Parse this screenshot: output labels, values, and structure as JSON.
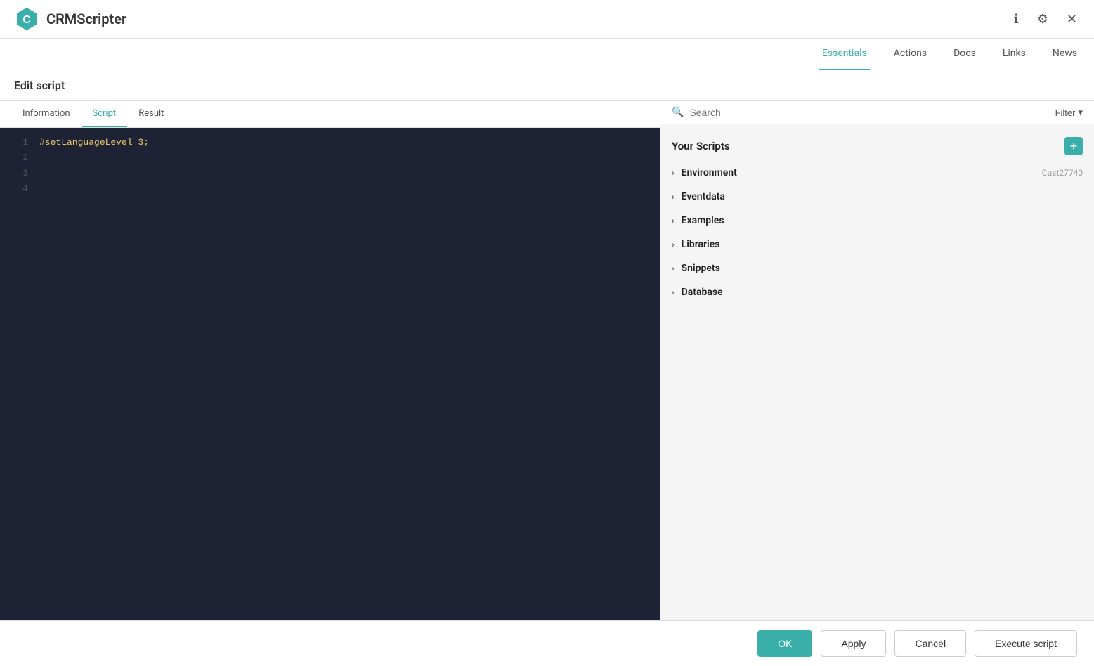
{
  "app": {
    "title": "CRMScripter",
    "logo_text": "C"
  },
  "nav": {
    "items": [
      {
        "id": "essentials",
        "label": "Essentials",
        "active": true
      },
      {
        "id": "actions",
        "label": "Actions",
        "active": false
      },
      {
        "id": "docs",
        "label": "Docs",
        "active": false
      },
      {
        "id": "links",
        "label": "Links",
        "active": false
      },
      {
        "id": "news",
        "label": "News",
        "active": false
      }
    ]
  },
  "page": {
    "title": "Edit script"
  },
  "tabs": [
    {
      "id": "information",
      "label": "Information",
      "active": false
    },
    {
      "id": "script",
      "label": "Script",
      "active": true
    },
    {
      "id": "result",
      "label": "Result",
      "active": false
    }
  ],
  "editor": {
    "lines": [
      {
        "number": "1",
        "content": "#setLanguageLevel 3;"
      },
      {
        "number": "2",
        "content": ""
      },
      {
        "number": "3",
        "content": ""
      },
      {
        "number": "4",
        "content": ""
      }
    ]
  },
  "search": {
    "placeholder": "Search",
    "value": "",
    "filter_label": "Filter"
  },
  "scripts_tree": {
    "header": "Your Scripts",
    "add_icon": "+",
    "cust_id": "Cust27740",
    "items": [
      {
        "id": "environment",
        "label": "Environment"
      },
      {
        "id": "eventdata",
        "label": "Eventdata"
      },
      {
        "id": "examples",
        "label": "Examples"
      },
      {
        "id": "libraries",
        "label": "Libraries"
      },
      {
        "id": "snippets",
        "label": "Snippets"
      },
      {
        "id": "database",
        "label": "Database"
      }
    ]
  },
  "footer": {
    "ok_label": "OK",
    "apply_label": "Apply",
    "cancel_label": "Cancel",
    "execute_label": "Execute script"
  },
  "icons": {
    "info": "ℹ",
    "settings": "⚙",
    "close": "✕",
    "search": "🔍",
    "chevron_down": "▾",
    "chevron_right": "›",
    "plus": "+"
  }
}
